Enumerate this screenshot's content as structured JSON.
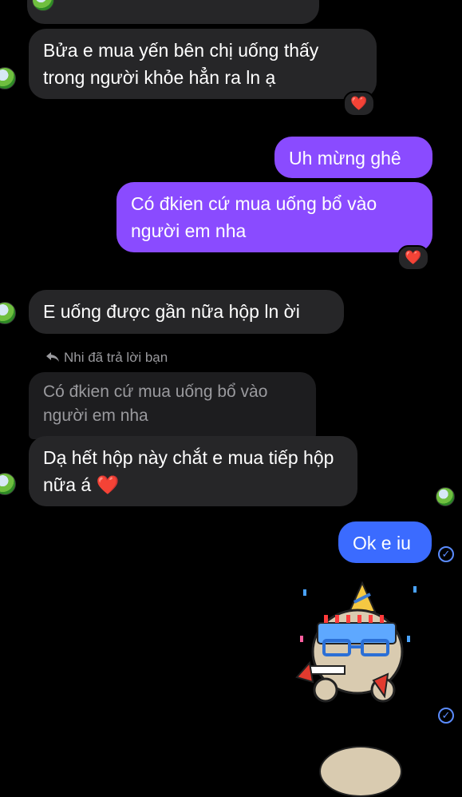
{
  "messages": {
    "m1": {
      "text": "Bửa e mua yến bên chị uống thấy trong người khỏe hẳn ra ln ạ",
      "reaction": "❤️"
    },
    "m2": {
      "text": "Uh mừng ghê"
    },
    "m3": {
      "text": "Có đkien cứ mua uống bổ vào người em nha",
      "reaction": "❤️"
    },
    "m4": {
      "text": "E uống được gần nữa hộp ln ời"
    },
    "reply": {
      "label": "Nhi đã trả lời bạn",
      "quoted": "Có đkien cứ mua uống bổ vào người em nha",
      "text": "Dạ hết hộp này chắt e mua tiếp hộp nữa á",
      "emoji": "❤️"
    },
    "m5": {
      "text": "Ok e iu"
    }
  },
  "icons": {
    "reply_arrow": "reply-arrow-icon",
    "seen": "check-circle-icon",
    "sticker": "birthday-dog-sticker"
  },
  "colors": {
    "incoming": "#262628",
    "outgoing_purple": "#8a4bff",
    "outgoing_blue": "#3b6bff",
    "heart": "#e82238"
  }
}
